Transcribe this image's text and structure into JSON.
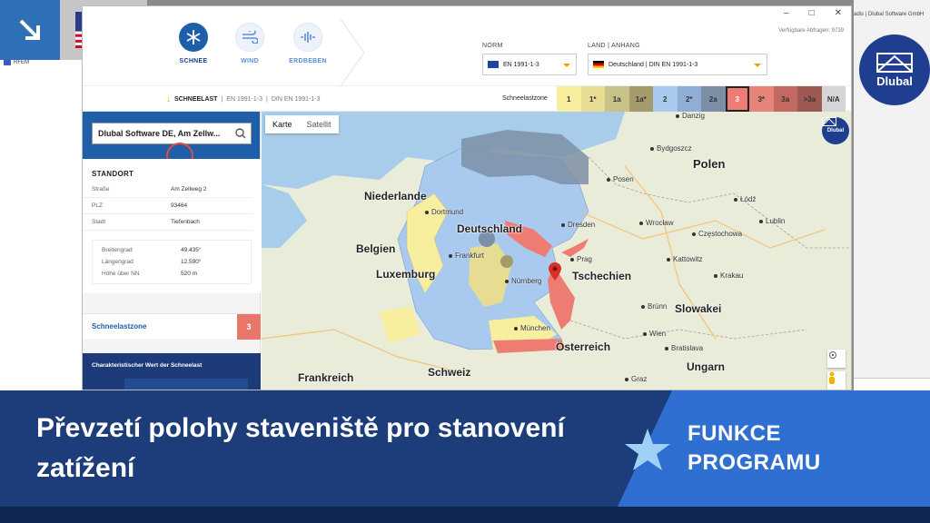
{
  "window": {
    "controls": [
      "–",
      "□",
      "✕"
    ],
    "available_queries": "Verfügbare Abfragen: 9739",
    "right_title": "adis | Dlubal Software GmbH"
  },
  "background": {
    "rfem_label": "RFEM",
    "dlubal_logo": "Dlubal"
  },
  "nav": [
    {
      "label": "SCHNEE",
      "icon": "snowflake-icon",
      "active": true
    },
    {
      "label": "WIND",
      "icon": "wind-icon",
      "active": false
    },
    {
      "label": "ERDBEBEN",
      "icon": "earthquake-icon",
      "active": false
    }
  ],
  "norm": {
    "label": "NORM",
    "value": "EN 1991-1-3"
  },
  "land": {
    "label": "LAND | ANHANG",
    "value": "Deutschland | DIN EN 1991-1-3"
  },
  "breadcrumb": {
    "main": "SCHNEELAST",
    "sep": "|",
    "norm": "EN 1991-1-3",
    "annex": "DIN EN 1991-1-3"
  },
  "zones_label": "Schneelastzone",
  "zones": [
    {
      "label": "1",
      "color": "#f7ef9e"
    },
    {
      "label": "1*",
      "color": "#e6dd93"
    },
    {
      "label": "1a",
      "color": "#c8c188"
    },
    {
      "label": "1a*",
      "color": "#a39b6c"
    },
    {
      "label": "2",
      "color": "#a9c9ef"
    },
    {
      "label": "2*",
      "color": "#90aed4"
    },
    {
      "label": "2a",
      "color": "#7d8fa6"
    },
    {
      "label": "3",
      "color": "#ee7c72",
      "active": true
    },
    {
      "label": "3*",
      "color": "#e6847a"
    },
    {
      "label": "3a",
      "color": "#c26a62"
    },
    {
      "label": ">3a",
      "color": "#9d5954"
    },
    {
      "label": "N/A",
      "color": "#d5d5d5"
    }
  ],
  "search": {
    "value": "Dlubal Software DE, Am Zellw..."
  },
  "location": {
    "title": "STANDORT",
    "street_label": "Straße",
    "street": "Am Zellweg 2",
    "zip_label": "PLZ",
    "zip": "93464",
    "city_label": "Stadt",
    "city": "Tiefenbach",
    "lat_label": "Breitengrad",
    "lat": "49.435°",
    "lon_label": "Längengrad",
    "lon": "12.590°",
    "alt_label": "Höhe über NN",
    "alt": "520 m"
  },
  "snow_zone": {
    "label": "Schneelastzone",
    "value": "3"
  },
  "char_value": {
    "title": "Charakteristischer Wert der Schneelast"
  },
  "map": {
    "tab_map": "Karte",
    "tab_sat": "Satellit",
    "countries": [
      "Niederlande",
      "Deutschland",
      "Polen",
      "Belgien",
      "Luxemburg",
      "Tschechien",
      "Slowakei",
      "Österreich",
      "Ungarn",
      "Frankreich",
      "Schweiz"
    ],
    "cities": [
      "Danzig",
      "Bydgoszcz",
      "Posen",
      "Łódź",
      "Lublin",
      "Wrocław",
      "Częstochowa",
      "Kattowitz",
      "Krakau",
      "Prag",
      "Brünn",
      "Nürnberg",
      "München",
      "Dresden",
      "Frankfurt",
      "Dortmund",
      "Wien",
      "Bratislava",
      "Graz"
    ]
  },
  "banner": {
    "title": "Převzetí polohy staveniště pro stanovení zatížení",
    "tag_line1": "FUNKCE",
    "tag_line2": "PROGRAMU"
  }
}
